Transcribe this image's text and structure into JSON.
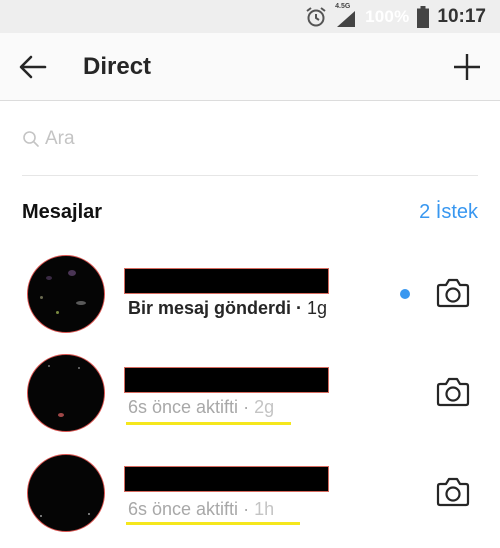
{
  "status_bar": {
    "icons": [
      "alarm-icon",
      "signal-4.5g-icon",
      "battery-icon"
    ],
    "network_label": "4.5G",
    "battery_percent": "100%",
    "time": "10:17"
  },
  "app_bar": {
    "back_icon": "arrow-left-icon",
    "title": "Direct",
    "new_message_icon": "plus-icon"
  },
  "search": {
    "icon": "search-icon",
    "placeholder": "Ara",
    "value": ""
  },
  "messages_section": {
    "title": "Mesajlar",
    "requests_link": "2 İstek"
  },
  "threads": [
    {
      "name": "[redacted]",
      "status_text": "Bir mesaj gönderdi",
      "separator": " · ",
      "time": "1g",
      "unread": true,
      "camera_icon": "camera-icon"
    },
    {
      "name": "[redacted]",
      "status_text": "6s önce aktifti",
      "separator": " · ",
      "time": "2g",
      "unread": false,
      "camera_icon": "camera-icon"
    },
    {
      "name": "[redacted]",
      "status_text": "6s önce aktifti",
      "separator": " · ",
      "time": "1h",
      "unread": false,
      "camera_icon": "camera-icon"
    }
  ],
  "colors": {
    "accent_blue": "#3897f0",
    "highlight_yellow": "#f5e71d",
    "redaction_border": "#d66a5e"
  }
}
